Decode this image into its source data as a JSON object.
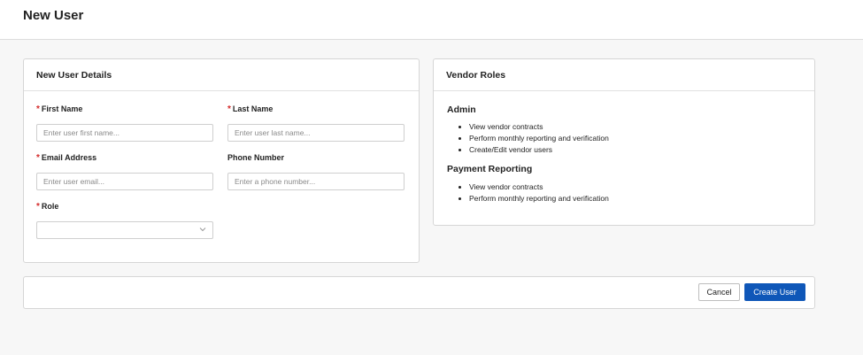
{
  "page": {
    "title": "New User"
  },
  "details": {
    "heading": "New User Details",
    "first_name": {
      "label": "First Name",
      "required": "*",
      "placeholder": "Enter user first name..."
    },
    "last_name": {
      "label": "Last Name",
      "required": "*",
      "placeholder": "Enter user last name..."
    },
    "email": {
      "label": "Email Address",
      "required": "*",
      "placeholder": "Enter user email..."
    },
    "phone": {
      "label": "Phone Number",
      "placeholder": "Enter a phone number..."
    },
    "role": {
      "label": "Role",
      "required": "*",
      "value": ""
    }
  },
  "roles": {
    "heading": "Vendor Roles",
    "items": [
      {
        "name": "Admin",
        "permissions": [
          "View vendor contracts",
          "Perform monthly reporting and verification",
          "Create/Edit vendor users"
        ]
      },
      {
        "name": "Payment Reporting",
        "permissions": [
          "View vendor contracts",
          "Perform monthly reporting and verification"
        ]
      }
    ]
  },
  "actions": {
    "cancel_label": "Cancel",
    "create_label": "Create User"
  },
  "colors": {
    "primary": "#0f57b8",
    "required": "#d42a2a"
  },
  "icons": {
    "role_select": "chevron-down-icon"
  }
}
